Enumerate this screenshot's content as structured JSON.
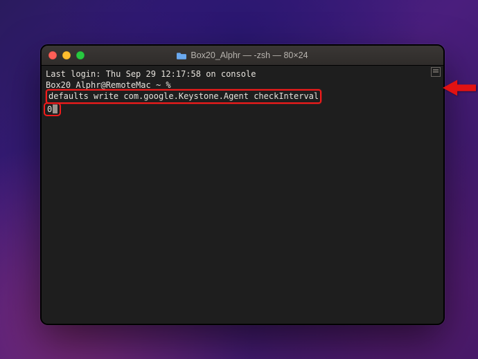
{
  "window": {
    "title": "Box20_Alphr — -zsh — 80×24"
  },
  "terminal": {
    "line1": "Last login: Thu Sep 29 12:17:58 on console",
    "prompt": "Box20_Alphr@RemoteMac ~ % ",
    "command_part1": "defaults write com.google.Keystone.Agent checkInterval",
    "command_part2_zero": "0"
  }
}
